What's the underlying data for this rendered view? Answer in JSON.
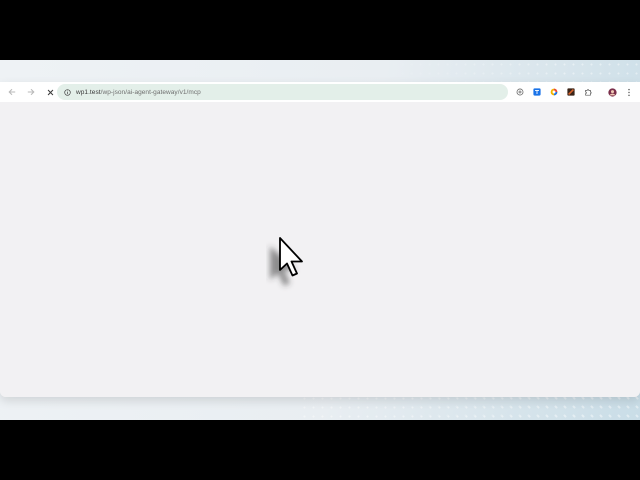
{
  "browser": {
    "url_host": "wp1.test",
    "url_path": "/wp-json/ai-agent-gateway/v1/mcp",
    "loading": true
  },
  "toolbar": {
    "back_icon": "arrow-left-icon",
    "forward_icon": "arrow-right-icon",
    "stop_icon": "close-icon",
    "site_info_icon": "info-circle-icon"
  },
  "extensions": [
    {
      "name": "lens-icon",
      "color": "#6b6b6b"
    },
    {
      "name": "translate-extension-icon",
      "color": "#1a73e8"
    },
    {
      "name": "color-wheel-extension-icon",
      "color": "#e8453c"
    },
    {
      "name": "dark-extension-icon",
      "color": "#b5451b"
    },
    {
      "name": "puzzle-icon",
      "color": "#555555"
    },
    {
      "name": "profile-avatar",
      "color": "#7a2e4a"
    },
    {
      "name": "kebab-menu-icon",
      "color": "#555555"
    }
  ],
  "colors": {
    "omnibox_bg": "#e3efe9",
    "page_bg": "#f2f1f3"
  }
}
